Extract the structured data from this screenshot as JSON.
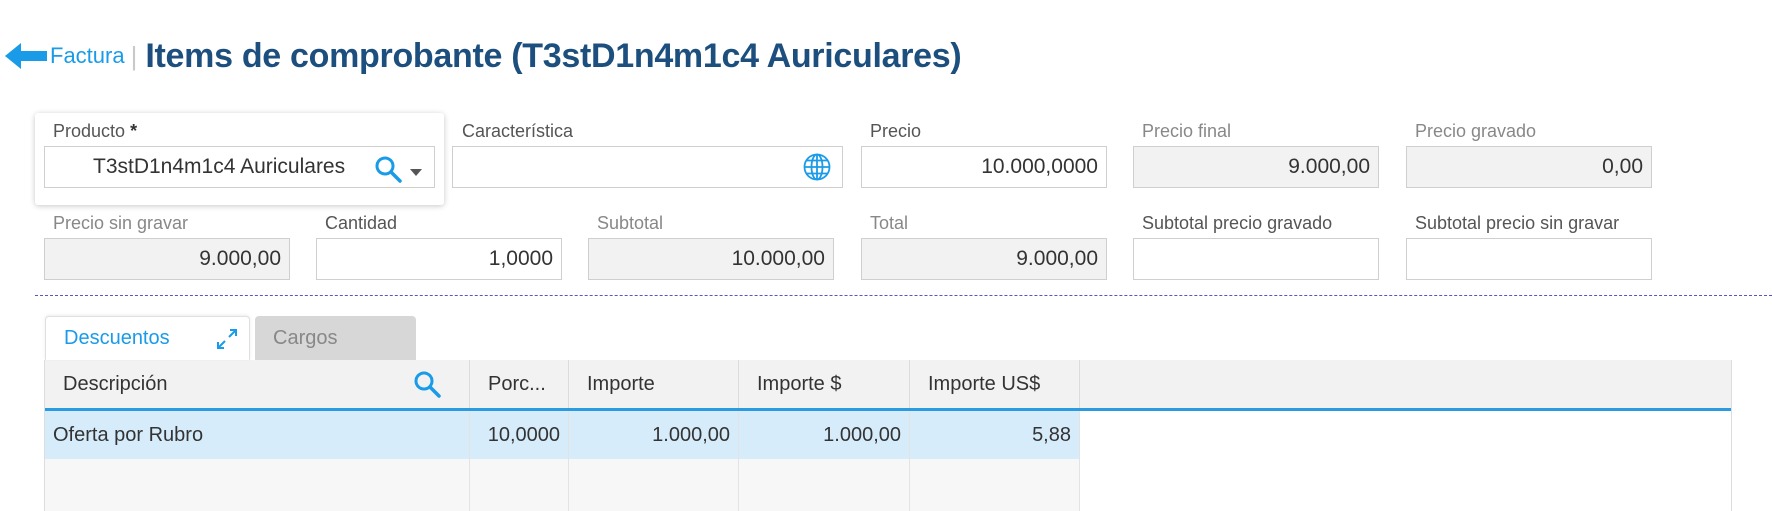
{
  "header": {
    "back_label": "Factura",
    "separator": "|",
    "title": "Items de comprobante (T3stD1n4m1c4 Auriculares)"
  },
  "form": {
    "producto": {
      "label": "Producto",
      "required_mark": "*",
      "value": "T3stD1n4m1c4 Auriculares"
    },
    "caracteristica": {
      "label": "Característica",
      "value": ""
    },
    "precio": {
      "label": "Precio",
      "value": "10.000,0000"
    },
    "precio_final": {
      "label": "Precio final",
      "value": "9.000,00"
    },
    "precio_gravado": {
      "label": "Precio gravado",
      "value": "0,00"
    },
    "precio_sin_gravar": {
      "label": "Precio sin gravar",
      "value": "9.000,00"
    },
    "cantidad": {
      "label": "Cantidad",
      "value": "1,0000"
    },
    "subtotal": {
      "label": "Subtotal",
      "value": "10.000,00"
    },
    "total": {
      "label": "Total",
      "value": "9.000,00"
    },
    "subtotal_precio_gravado": {
      "label": "Subtotal precio gravado",
      "value": ""
    },
    "subtotal_precio_sin_gravar": {
      "label": "Subtotal precio sin gravar",
      "value": ""
    }
  },
  "tabs": [
    {
      "label": "Descuentos",
      "active": true
    },
    {
      "label": "Cargos",
      "active": false
    }
  ],
  "grid": {
    "columns": [
      "Descripción",
      "Porc...",
      "Importe",
      "Importe $",
      "Importe US$"
    ],
    "rows": [
      {
        "descripcion": "Oferta por Rubro",
        "porc": "10,0000",
        "importe": "1.000,00",
        "importe_ars": "1.000,00",
        "importe_usd": "5,88"
      }
    ]
  },
  "colors": {
    "accent": "#1a9be8",
    "title": "#1d4f7e",
    "selected_row": "#d6ecfa",
    "readonly_field": "#f2f2f2"
  },
  "icons": [
    "arrow-left-icon",
    "search-icon",
    "chevron-down-icon",
    "globe-icon",
    "expand-icon"
  ]
}
